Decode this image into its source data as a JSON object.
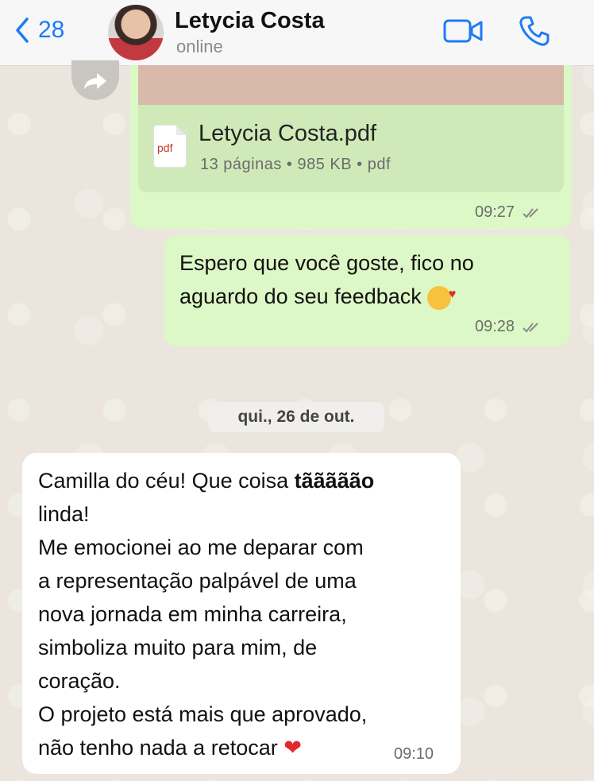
{
  "header": {
    "back_count": "28",
    "contact_name": "Letycia Costa",
    "status": "online"
  },
  "messages": {
    "document": {
      "icon_label": "pdf",
      "file_name": "Letycia Costa.pdf",
      "meta": "13 páginas • 985 KB • pdf",
      "time": "09:27"
    },
    "outgoing_text": {
      "line1": "Espero que você goste, fico no",
      "line2": "aguardo do seu feedback",
      "time": "09:28"
    },
    "date_separator": "qui., 26 de out.",
    "incoming": {
      "lines": [
        "Camilla do céu! Que coisa ",
        "tããããão",
        "linda!",
        "Me emocionei ao me deparar com",
        "a representação palpável de uma",
        "nova jornada em minha carreira,",
        "simboliza muito para mim, de",
        "coração.",
        "O projeto está mais que aprovado,",
        "não tenho nada a retocar"
      ],
      "time": "09:10"
    }
  },
  "colors": {
    "accent": "#1d7bf5",
    "outgoing_bubble": "#dcf8c6",
    "incoming_bubble": "#ffffff"
  },
  "icons": [
    "chevron-left-icon",
    "video-camera-icon",
    "phone-icon",
    "forward-icon",
    "pdf-file-icon",
    "double-check-icon",
    "heart-emoji",
    "smiling-face-with-hearts-emoji"
  ]
}
